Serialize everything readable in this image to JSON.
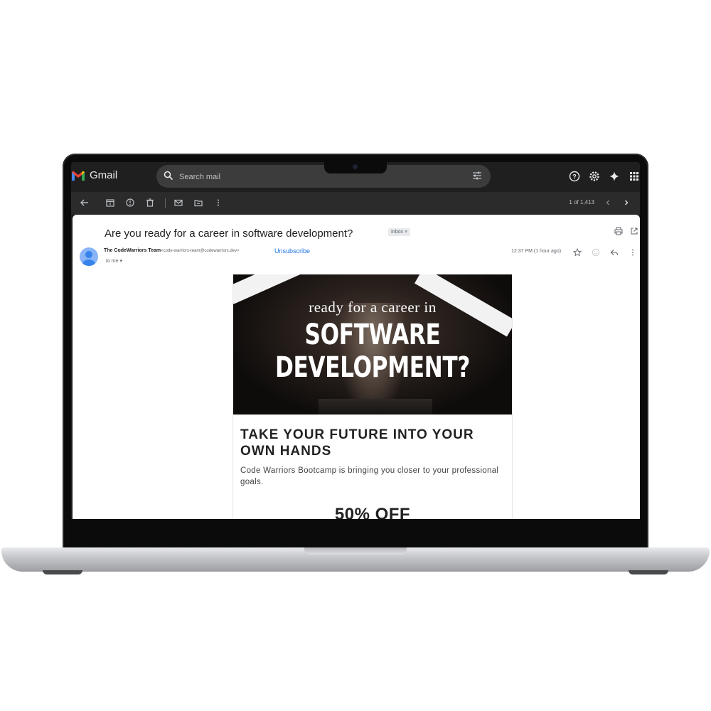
{
  "app": {
    "name": "Gmail"
  },
  "search": {
    "placeholder": "Search mail"
  },
  "toolbar": {
    "page_count": "1 of 1,413"
  },
  "message": {
    "subject": "Are you ready for a career in software development?",
    "label_chip": "Inbox",
    "label_chip_close": "×",
    "sender_name": "The CodeWarriors Team",
    "sender_email": "<code-warriors-team@codewarriors.dev>",
    "unsubscribe": "Unsubscribe",
    "recipient": "to me",
    "timestamp": "12:37 PM (1 hour ago)"
  },
  "email_body": {
    "hero_line1": "ready for a career in",
    "hero_line2": "SOFTWARE",
    "hero_line3": "DEVELOPMENT?",
    "headline": "TAKE YOUR FUTURE INTO YOUR OWN HANDS",
    "subtext": "Code Warriors Bootcamp is bringing you closer to your professional goals.",
    "offer": "50% OFF"
  },
  "icons": {
    "header": [
      "help-icon",
      "settings-icon",
      "gemini-icon",
      "apps-grid-icon"
    ],
    "toolbar": [
      "back-arrow-icon",
      "archive-icon",
      "report-spam-icon",
      "delete-icon",
      "mark-unread-icon",
      "move-to-icon",
      "more-vert-icon",
      "prev-icon",
      "next-icon"
    ],
    "message": [
      "print-icon",
      "open-new-window-icon",
      "star-icon",
      "emoji-icon",
      "reply-icon",
      "more-vert-icon"
    ]
  },
  "colors": {
    "header_bg": "#1f1f1f",
    "toolbar_bg": "#2b2b2b",
    "link_blue": "#1a73e8",
    "gmail_red": "#ea4335",
    "avatar_blue": "#8ab4f8"
  }
}
